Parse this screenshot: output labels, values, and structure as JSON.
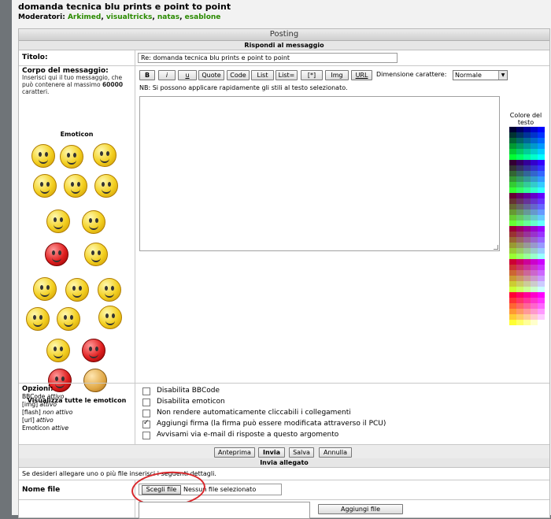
{
  "topic": {
    "title": "domanda tecnica blu prints e point to point",
    "moderators_label": "Moderatori:",
    "moderators": [
      "Arkimed",
      "visualtricks",
      "natas",
      "esablone"
    ]
  },
  "posting": {
    "header": "Posting",
    "subheader": "Rispondi al messaggio",
    "title_label": "Titolo:",
    "title_value": "Re: domanda tecnica blu prints e point to point",
    "body_label": "Corpo del messaggio:",
    "body_hint": "Inserisci qui il tuo messaggio, che può contenere al massimo",
    "body_limit": "60000",
    "body_hint_suffix": "caratteri.",
    "emoticon_title": "Emoticon",
    "view_all_emoticons": "Visualizza tutte le emoticon",
    "toolbar": {
      "buttons": [
        "B",
        "i",
        "u",
        "Quote",
        "Code",
        "List",
        "List=",
        "[*]",
        "Img",
        "URL"
      ],
      "font_size_label": "Dimensione carattere:",
      "font_size_value": "Normale"
    },
    "nb_text": "NB: Si possono applicare rapidamente gli stili al testo selezionato.",
    "color_label": "Colore del testo"
  },
  "options": {
    "label": "Opzioni:",
    "status": [
      {
        "name": "BBCode",
        "state": "attivo"
      },
      {
        "name": "[img]",
        "state": "attivo"
      },
      {
        "name": "[flash]",
        "state": "non attivo"
      },
      {
        "name": "[url]",
        "state": "attivo"
      },
      {
        "name": "Emoticon",
        "state": "attive"
      }
    ],
    "checkboxes": [
      {
        "label": "Disabilita BBCode",
        "checked": false
      },
      {
        "label": "Disabilita emoticon",
        "checked": false
      },
      {
        "label": "Non rendere automaticamente cliccabili i collegamenti",
        "checked": false
      },
      {
        "label": "Aggiungi firma (la firma può essere modificata attraverso il PCU)",
        "checked": true
      },
      {
        "label": "Avvisami via e-mail di risposte a questo argomento",
        "checked": false
      }
    ]
  },
  "actions": {
    "preview": "Anteprima",
    "submit": "Invia",
    "save": "Salva",
    "cancel": "Annulla"
  },
  "attachment": {
    "header": "Invia allegato",
    "hint": "Se desideri allegare uno o più file inserisci i seguenti dettagli.",
    "filename_label": "Nome file",
    "choose_button": "Scegli file",
    "no_file": "Nessun file selezionato",
    "add_button": "Aggiungi file"
  },
  "colors": {
    "moderator_link": "#2a8a00",
    "annotation_circle": "#d8262a"
  }
}
